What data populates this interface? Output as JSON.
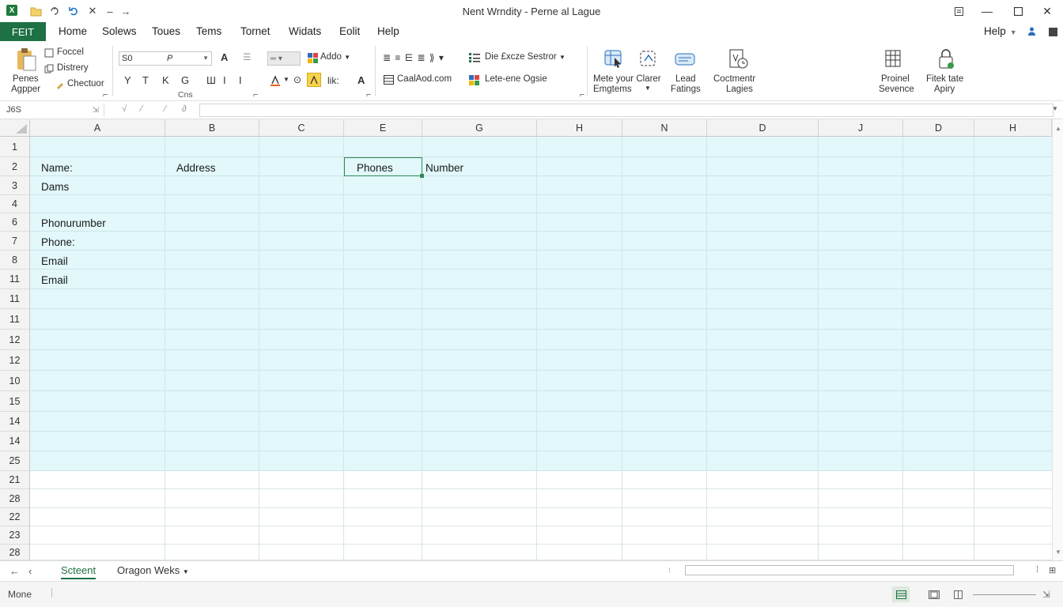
{
  "titlebar": {
    "title": "Nent Wrndity - Perne al Lague",
    "minimize_icon": "minimize-icon",
    "maximize_icon": "maximize-icon",
    "close_icon": "close-icon"
  },
  "menu": {
    "file": "FEIT",
    "items": [
      "Home",
      "Solews",
      "Toues",
      "Tems",
      "Tornet",
      "Widats",
      "Eolit",
      "Help"
    ],
    "help_right": "Help"
  },
  "ribbon": {
    "clipboard": {
      "paste": "Penes",
      "paste2": "Agpper",
      "items": [
        "Foccel",
        "Distrery",
        "Chectuor"
      ]
    },
    "font": {
      "font_name": "S0",
      "font_size": "P",
      "group_label": "Cns",
      "buttons": [
        "Y",
        "T",
        "K",
        "G",
        "Ш",
        "I",
        "I"
      ],
      "lik": "lik:"
    },
    "alignment": {
      "addo": "Addo",
      "dropdown": "Die £xcze Sestror",
      "caladd": "CaalAod.com",
      "letene": "Lete-ene Ogsie"
    },
    "groups": [
      {
        "label1": "Mete your Clarer",
        "label2": "Emgtems"
      },
      {
        "label1": "Lead",
        "label2": "Fatings"
      },
      {
        "label1": "Coctmentr",
        "label2": "Lagies"
      },
      {
        "label1": "Proinel",
        "label2": "Sevence"
      },
      {
        "label1": "Fitek tate",
        "label2": "Apiry"
      }
    ],
    "accent_color": "#1e7145"
  },
  "formula": {
    "name_box": "J6S",
    "value": ""
  },
  "grid": {
    "columns": [
      "A",
      "B",
      "C",
      "E",
      "G",
      "H",
      "N",
      "D",
      "J",
      "D",
      "H"
    ],
    "rows": [
      "1",
      "2",
      "3",
      "4",
      "6",
      "7",
      "8",
      "11",
      "11",
      "11",
      "12",
      "12",
      "10",
      "15",
      "14",
      "14",
      "25",
      "21",
      "28",
      "22",
      "23",
      "28"
    ],
    "cells": {
      "a2": "Name:",
      "b2": "Address",
      "e2": "Phones",
      "g2": "Number",
      "a3": "Dams",
      "a6": "Phonurumber",
      "a7": "Phone:",
      "a8": "Email",
      "a11": "Email"
    },
    "shade_color": "#e2f8fb"
  },
  "sheets": {
    "tabs": [
      "Scteent",
      "Oragon Weks"
    ],
    "active": "Scteent"
  },
  "status": {
    "text": "Mone"
  }
}
